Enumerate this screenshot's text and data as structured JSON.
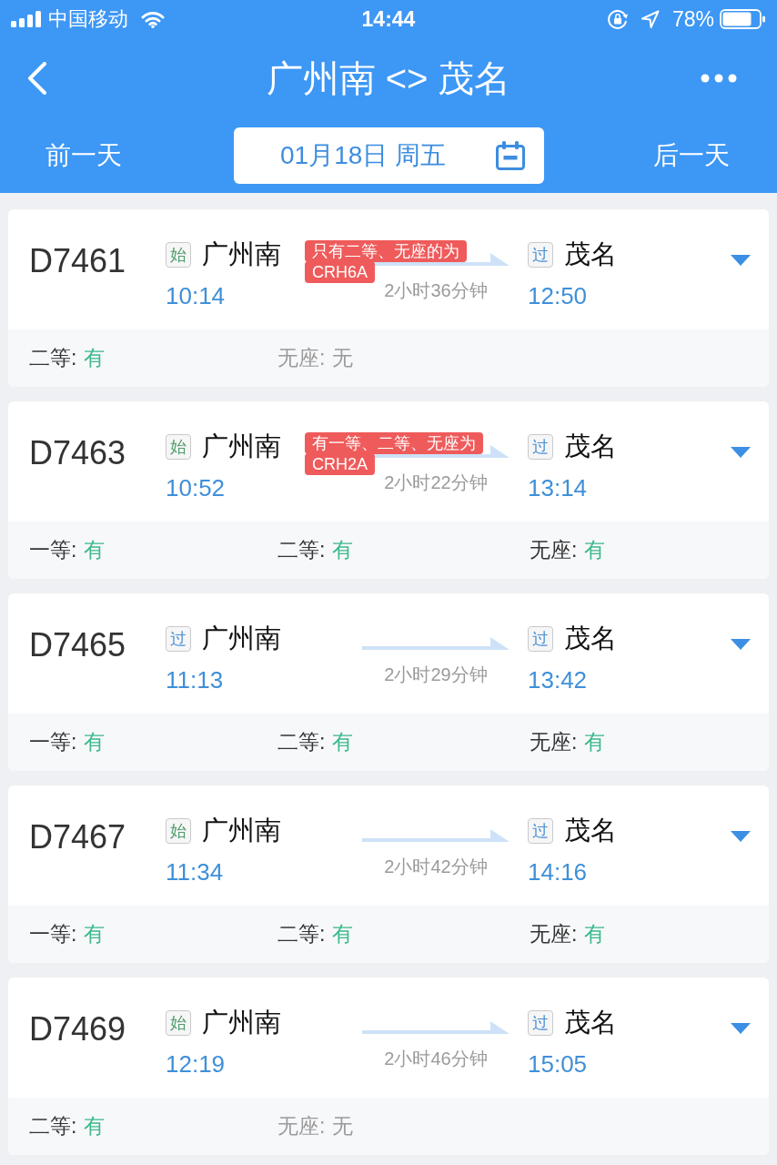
{
  "status_bar": {
    "carrier": "中国移动",
    "time": "14:44",
    "battery": "78%"
  },
  "nav": {
    "title": "广州南 <> 茂名"
  },
  "date_bar": {
    "prev": "前一天",
    "date": "01月18日 周五",
    "next": "后一天"
  },
  "trains": [
    {
      "number": "D7461",
      "from": {
        "badge": "始",
        "kind": "origin",
        "name": "广州南",
        "time": "10:14"
      },
      "note": "只有二等、无座的为\nCRH6A",
      "duration": "2小时36分钟",
      "to": {
        "badge": "过",
        "kind": "passing",
        "name": "茂名",
        "time": "12:50"
      },
      "seats": [
        {
          "label": "二等:",
          "value": "有",
          "available": true
        },
        {
          "label": "无座:",
          "value": "无",
          "available": false
        }
      ]
    },
    {
      "number": "D7463",
      "from": {
        "badge": "始",
        "kind": "origin",
        "name": "广州南",
        "time": "10:52"
      },
      "note": "有一等、二等、无座为\nCRH2A",
      "duration": "2小时22分钟",
      "to": {
        "badge": "过",
        "kind": "passing",
        "name": "茂名",
        "time": "13:14"
      },
      "seats": [
        {
          "label": "一等:",
          "value": "有",
          "available": true
        },
        {
          "label": "二等:",
          "value": "有",
          "available": true
        },
        {
          "label": "无座:",
          "value": "有",
          "available": true
        }
      ]
    },
    {
      "number": "D7465",
      "from": {
        "badge": "过",
        "kind": "passing",
        "name": "广州南",
        "time": "11:13"
      },
      "duration": "2小时29分钟",
      "to": {
        "badge": "过",
        "kind": "passing",
        "name": "茂名",
        "time": "13:42"
      },
      "seats": [
        {
          "label": "一等:",
          "value": "有",
          "available": true
        },
        {
          "label": "二等:",
          "value": "有",
          "available": true
        },
        {
          "label": "无座:",
          "value": "有",
          "available": true
        }
      ]
    },
    {
      "number": "D7467",
      "from": {
        "badge": "始",
        "kind": "origin",
        "name": "广州南",
        "time": "11:34"
      },
      "duration": "2小时42分钟",
      "to": {
        "badge": "过",
        "kind": "passing",
        "name": "茂名",
        "time": "14:16"
      },
      "seats": [
        {
          "label": "一等:",
          "value": "有",
          "available": true
        },
        {
          "label": "二等:",
          "value": "有",
          "available": true
        },
        {
          "label": "无座:",
          "value": "有",
          "available": true
        }
      ]
    },
    {
      "number": "D7469",
      "from": {
        "badge": "始",
        "kind": "origin",
        "name": "广州南",
        "time": "12:19"
      },
      "duration": "2小时46分钟",
      "to": {
        "badge": "过",
        "kind": "passing",
        "name": "茂名",
        "time": "15:05"
      },
      "seats": [
        {
          "label": "二等:",
          "value": "有",
          "available": true
        },
        {
          "label": "无座:",
          "value": "无",
          "available": false
        }
      ]
    }
  ]
}
